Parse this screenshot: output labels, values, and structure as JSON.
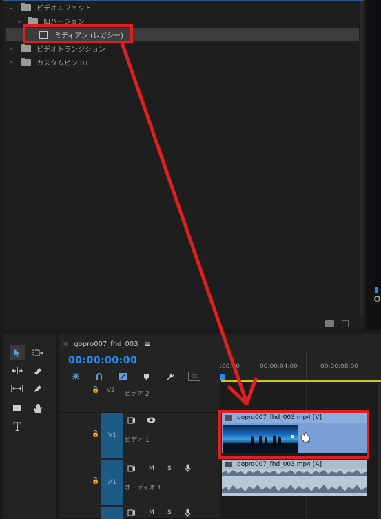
{
  "effects": {
    "items": [
      {
        "label": "ビデオエフェクト"
      },
      {
        "label": "旧バージョン"
      },
      {
        "label": "ミディアン (レガシー)"
      },
      {
        "label": "ビデオトランジション"
      },
      {
        "label": "カスタムビン 01"
      }
    ]
  },
  "tools": {
    "type_glyph": "T"
  },
  "timeline": {
    "close_glyph": "×",
    "sequence_name": "gopro007_fhd_003",
    "menu_glyph": "≡",
    "timecode": "00:00:00:00",
    "cc_label": "CC",
    "ruler": [
      ":00:00",
      "00:00:04:00",
      "00:00:08:00"
    ],
    "tracks": {
      "v2": {
        "id": "V2",
        "name": "ビデオ 2"
      },
      "v1": {
        "id": "V1",
        "name": "ビデオ 1"
      },
      "a1": {
        "id": "A1",
        "name": "オーディオ 1",
        "m": "M",
        "s": "S"
      },
      "a2": {
        "m": "M",
        "s": "S"
      }
    },
    "clips": {
      "video": "gopro007_fhd_003.mp4 [V]",
      "audio": "gopro007_fhd_003.mp4 [A]"
    }
  },
  "annotation": {
    "color": "#e02020"
  }
}
